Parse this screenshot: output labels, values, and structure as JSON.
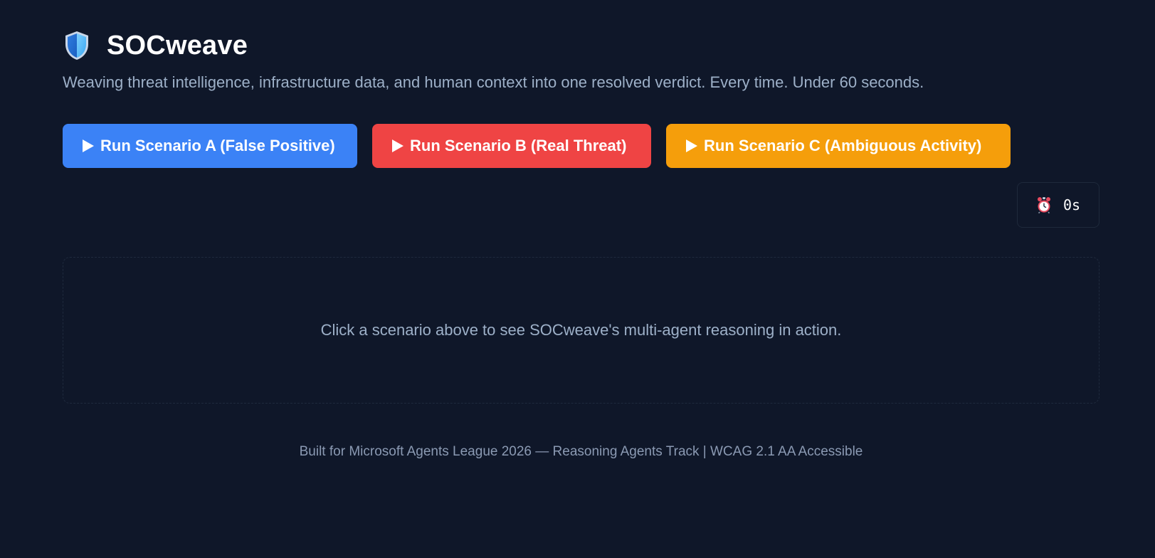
{
  "app": {
    "title": "SOCweave",
    "subtitle": "Weaving threat intelligence, infrastructure data, and human context into one resolved verdict. Every time. Under 60 seconds.",
    "logo_icon": "shield-icon"
  },
  "scenarios": [
    {
      "label": "Run Scenario A (False Positive)",
      "color": "#3b82f6",
      "icon": "play-icon"
    },
    {
      "label": "Run Scenario B (Real Threat)",
      "color": "#ef4444",
      "icon": "play-icon"
    },
    {
      "label": "Run Scenario C (Ambiguous Activity)",
      "color": "#f59e0b",
      "icon": "play-icon"
    }
  ],
  "timer": {
    "icon": "alarm-clock-icon",
    "value": "0s"
  },
  "output_panel": {
    "placeholder": "Click a scenario above to see SOCweave's multi-agent reasoning in action."
  },
  "footer": {
    "text": "Built for Microsoft Agents League 2026 — Reasoning Agents Track | WCAG 2.1 AA Accessible"
  },
  "colors": {
    "background": "#0f1729",
    "muted_text": "#9db0c8",
    "accent_blue": "#3b82f6",
    "accent_red": "#ef4444",
    "accent_amber": "#f59e0b"
  }
}
